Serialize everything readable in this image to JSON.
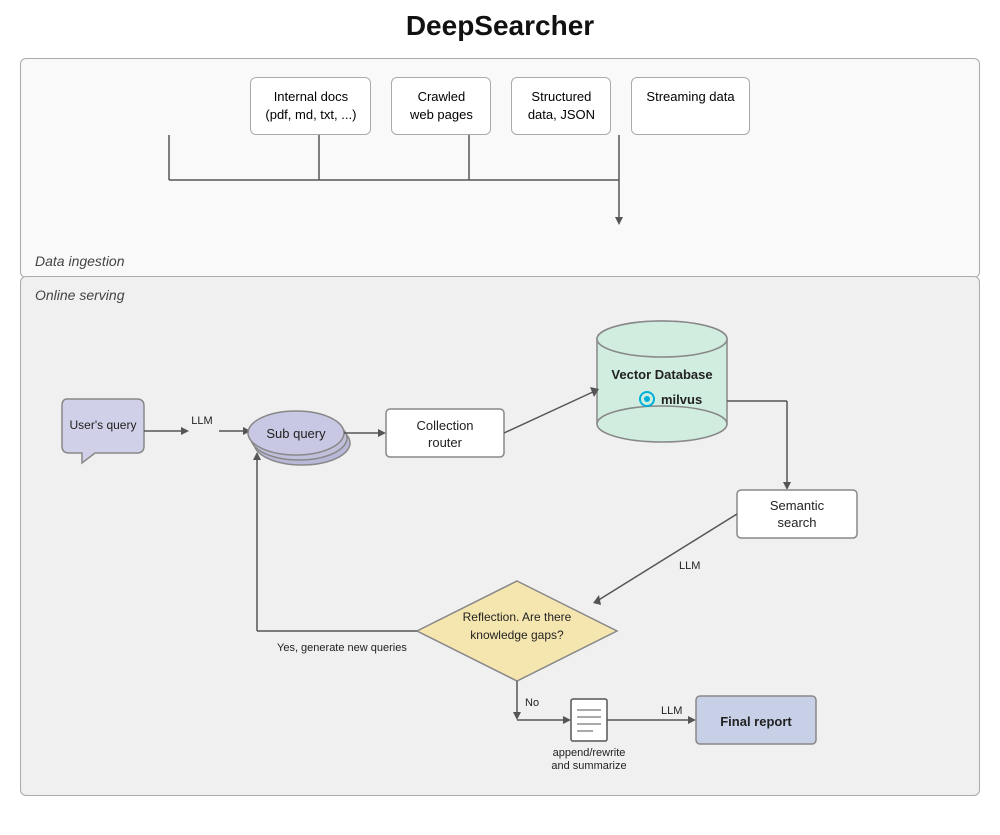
{
  "title": "DeepSearcher",
  "data_ingestion": {
    "label": "Data ingestion",
    "sources": [
      {
        "id": "internal-docs",
        "text": "Internal docs\n(pdf, md, txt, ...)"
      },
      {
        "id": "crawled-pages",
        "text": "Crawled\nweb pages"
      },
      {
        "id": "structured-data",
        "text": "Structured\ndata, JSON"
      },
      {
        "id": "streaming-data",
        "text": "Streaming data"
      }
    ]
  },
  "online_serving": {
    "label": "Online serving",
    "nodes": {
      "user_query": "User's query",
      "llm_label1": "LLM",
      "sub_query": "Sub query",
      "collection_router": "Collection router",
      "vector_db": "Vector Database",
      "milvus": "milvus",
      "semantic_search": "Semantic search",
      "llm_label2": "LLM",
      "reflection": "Reflection. Are there\nknowledge gaps?",
      "yes_label": "Yes, generate new queries",
      "no_label": "No",
      "summarize_icon": "📋",
      "summarize_label": "append/rewrite\nand summarize",
      "llm_label3": "LLM",
      "final_report": "Final report"
    }
  }
}
